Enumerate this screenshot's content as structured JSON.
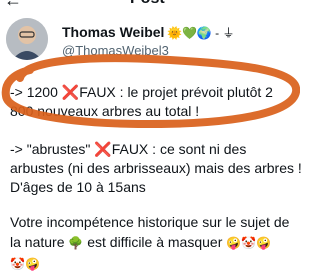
{
  "header": {
    "title": "Post"
  },
  "author": {
    "name": "Thomas Weibel",
    "emoji_suffix": "🌞💚🌍 - ⏚",
    "handle": "@ThomasWeibel3"
  },
  "post": {
    "line1": "-> 1200 ",
    "x_mark": "❌",
    "line1_rest": "FAUX : le projet prévoit plutôt 2",
    "line2": "800 nouveaux arbres au total !",
    "line3_a": "-> \"abrustes\" ",
    "line3_x": "❌",
    "line3_b": "FAUX : ce sont ni des",
    "line4": "arbustes (ni des arbrisseaux) mais des arbres !",
    "line5": "D'âges de 10 à 15ans",
    "line6": "Votre incompétence historique sur le sujet de",
    "line7_a": "la nature ",
    "line7_tree": "🌳",
    "line7_b": " est difficile à masquer ",
    "line7_emojis": "🤪🤡🤪",
    "line8_emojis": "🤡🤪"
  },
  "colors": {
    "annotation": "#d9601a",
    "accent_red": "#e0242b"
  }
}
